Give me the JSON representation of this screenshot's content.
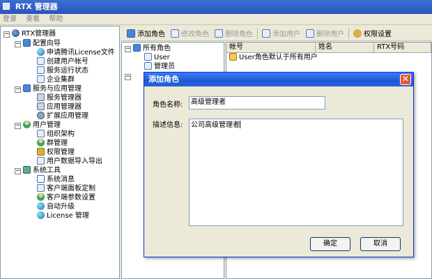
{
  "window": {
    "title": "RTX 管理器"
  },
  "menu": [
    "登录",
    "查看",
    "帮助"
  ],
  "nav_tree": {
    "root": "RTX管理器",
    "groups": [
      {
        "label": "配置向导",
        "items": [
          "申请腾讯License文件",
          "创建用户帐号",
          "服务运行状态",
          "企业集群"
        ]
      },
      {
        "label": "服务与应用管理",
        "items": [
          "服务管理器",
          "应用管理器",
          "扩展应用管理"
        ]
      },
      {
        "label": "用户管理",
        "items": [
          "组织架构",
          "群管理",
          "权限管理",
          "用户数据导入导出"
        ]
      },
      {
        "label": "系统工具",
        "items": [
          "系统消息",
          "客户端面板定制",
          "客户端参数设置",
          "自动升级",
          "License 管理"
        ]
      }
    ]
  },
  "toolbar": {
    "add_role": "添加角色",
    "edit_role": "修改角色",
    "delete_role": "删除角色",
    "add_user": "添加用户",
    "delete_user": "删除用户",
    "permission_settings": "权限设置"
  },
  "role_tree": {
    "root": "所有角色",
    "items": [
      "User",
      "管理员"
    ]
  },
  "user_list": {
    "columns": [
      "帐号",
      "姓名",
      "RTX号码"
    ],
    "rows": [
      "User角色默认于所有用户"
    ]
  },
  "dialog": {
    "title": "添加角色",
    "role_name_label": "角色名称:",
    "role_name_value": "高级管理者",
    "description_label": "描述信息:",
    "description_value": "公司高级管理者",
    "ok": "确定",
    "cancel": "取消"
  }
}
